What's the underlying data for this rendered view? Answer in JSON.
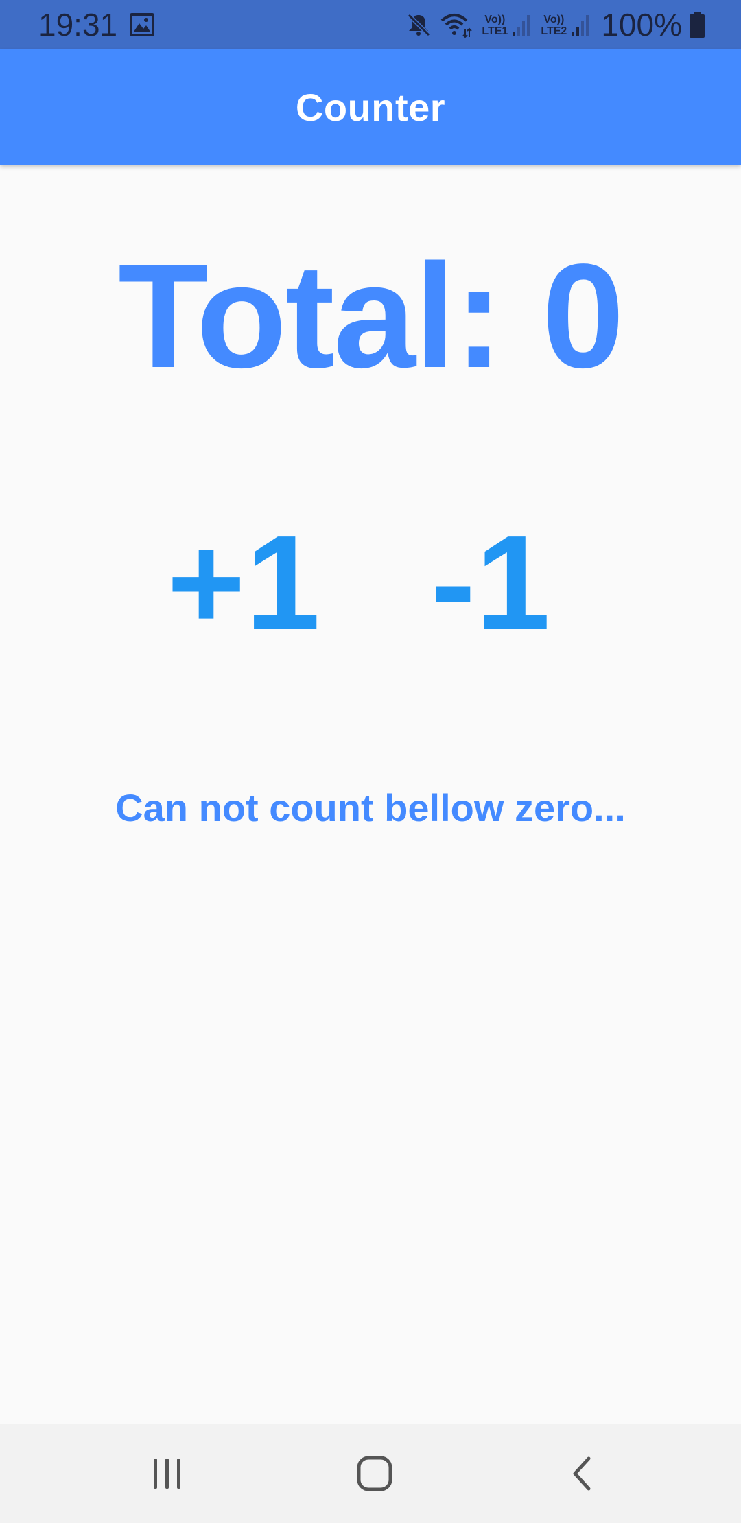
{
  "status_bar": {
    "time": "19:31",
    "sim1": {
      "volte": "Vo))",
      "network": "LTE1"
    },
    "sim2": {
      "volte": "Vo))",
      "network": "LTE2"
    },
    "battery": "100%",
    "icons": [
      "image-icon",
      "mute-icon",
      "wifi-icon",
      "signal-icon",
      "battery-icon"
    ]
  },
  "app_bar": {
    "title": "Counter"
  },
  "counter": {
    "total_text": "Total: 0",
    "increment_label": "+1",
    "decrement_label": "-1",
    "warning": "Can not count bellow zero..."
  },
  "nav_bar": {
    "icons": [
      "recent-apps-icon",
      "home-icon",
      "back-icon"
    ]
  },
  "colors": {
    "status_bar": "#3f6dc6",
    "app_bar": "#448aff",
    "total_text": "#448aff",
    "buttons": "#2196f3",
    "background": "#fafafa",
    "nav_bar": "#f2f2f2"
  }
}
